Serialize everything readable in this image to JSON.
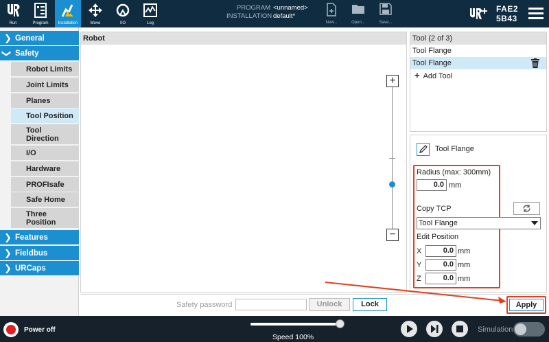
{
  "topbar": {
    "nav": [
      {
        "label": "Run",
        "icon": "ur-logo-icon"
      },
      {
        "label": "Program",
        "icon": "program-icon"
      },
      {
        "label": "Installation",
        "icon": "installation-icon"
      },
      {
        "label": "Move",
        "icon": "move-icon"
      },
      {
        "label": "I/O",
        "icon": "io-icon"
      },
      {
        "label": "Log",
        "icon": "log-icon"
      }
    ],
    "program_key": "PROGRAM",
    "program_value": "<unnamed>",
    "installation_key": "INSTALLATION",
    "installation_value": "default*",
    "file_buttons": [
      {
        "label": "New...",
        "icon": "new-file-icon"
      },
      {
        "label": "Open...",
        "icon": "open-folder-icon"
      },
      {
        "label": "Save...",
        "icon": "save-icon"
      }
    ],
    "robot_name_line1": "FAE2",
    "robot_name_line2": "5B43",
    "accent": "#1c8fd1",
    "bg": "#0f2c40"
  },
  "sidebar": {
    "general": "General",
    "safety": "Safety",
    "items": [
      "Robot Limits",
      "Joint Limits",
      "Planes",
      "Tool Position",
      "Tool Direction",
      "I/O",
      "Hardware",
      "PROFIsafe",
      "Safe Home",
      "Three Position"
    ],
    "features": "Features",
    "fieldbus": "Fieldbus",
    "urcaps": "URCaps"
  },
  "robot_panel": {
    "title": "Robot"
  },
  "tool_panel": {
    "title": "Tool (2 of 3)",
    "items": [
      "Tool Flange",
      "Tool Flange"
    ],
    "add_label": "Add Tool"
  },
  "props": {
    "tool_name": "Tool Flange",
    "radius_label": "Radius (max: 300mm)",
    "radius_value": "0.0",
    "radius_unit": "mm",
    "copy_tcp_label": "Copy TCP",
    "tcp_selected": "Tool Flange",
    "edit_position_label": "Edit Position",
    "x_label": "X",
    "x_value": "0.0",
    "y_label": "Y",
    "y_value": "0.0",
    "z_label": "Z",
    "z_value": "0.0",
    "unit": "mm",
    "highlight_color": "#e0401d"
  },
  "bottom": {
    "password_label": "Safety password",
    "unlock": "Unlock",
    "lock": "Lock",
    "apply": "Apply"
  },
  "footer": {
    "power": "Power off",
    "speed": "Speed 100%",
    "speed_fraction": 1.0,
    "simulation": "Simulation"
  }
}
